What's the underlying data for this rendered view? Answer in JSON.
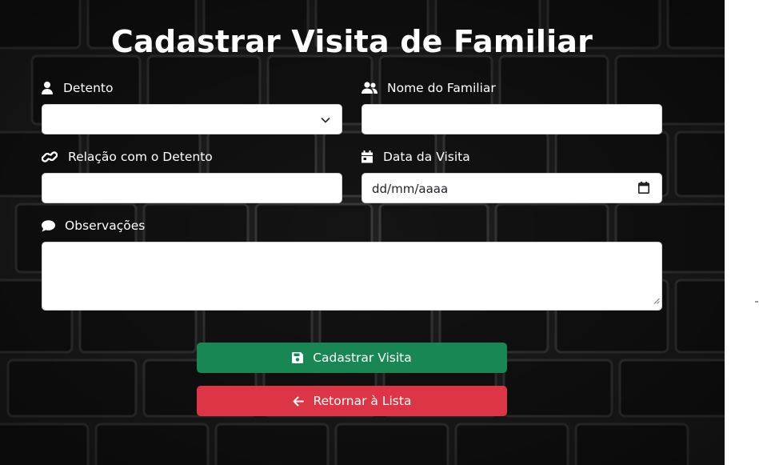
{
  "page": {
    "title": "Cadastrar Visita de Familiar"
  },
  "form": {
    "detento": {
      "label": "Detento",
      "icon": "user-icon",
      "selected": ""
    },
    "nome_familiar": {
      "label": "Nome do Familiar",
      "icon": "users-icon",
      "value": ""
    },
    "relacao": {
      "label": "Relação com o Detento",
      "icon": "link-icon",
      "value": ""
    },
    "data_visita": {
      "label": "Data da Visita",
      "icon": "calendar-icon",
      "placeholder": "dd/mm/aaaa"
    },
    "observacoes": {
      "label": "Observações",
      "icon": "comment-icon",
      "value": ""
    }
  },
  "actions": {
    "submit": {
      "label": "Cadastrar Visita",
      "icon": "save-icon",
      "color": "#198754"
    },
    "back": {
      "label": "Retornar à Lista",
      "icon": "arrow-left-icon",
      "color": "#dc3545"
    }
  },
  "theme": {
    "background": "dark brick wall",
    "label_color": "#ffffff"
  }
}
